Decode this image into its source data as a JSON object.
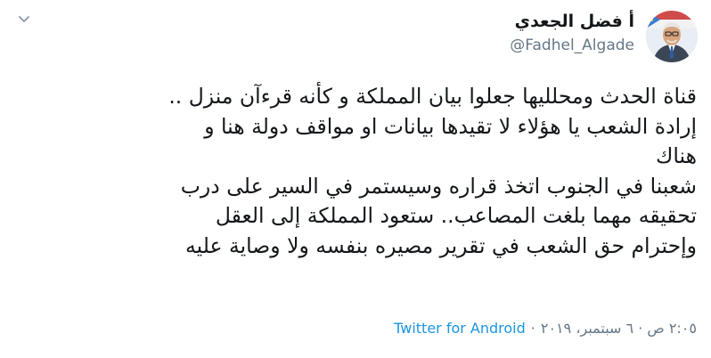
{
  "tweet": {
    "author": {
      "display_name": "أ فضل الجعدي",
      "handle": "@Fadhel_Algade"
    },
    "text": "قناة الحدث ومحلليها جعلوا بيان المملكة و كأنه قرءآن منزل ..\nإرادة الشعب يا هؤلاء لا تقيدها بيانات او مواقف دولة هنا و\nهناك\nشعبنا في الجنوب اتخذ قراره وسيستمر في السير على درب\nتحقيقه مهما بلغت المصاعب.. ستعود المملكة إلى العقل\nوإحترام حق الشعب في تقرير مصيره بنفسه ولا وصاية عليه",
    "timestamp": "٢:٠٥ ص · ٦ سبتمبر، ٢٠١٩",
    "separator": "·",
    "source": "Twitter for Android"
  },
  "colors": {
    "text": "#14171a",
    "secondary": "#657786",
    "link": "#1b95e0",
    "background": "#ffffff"
  },
  "icons": {
    "menu": "chevron-down-icon",
    "avatar": "profile-photo"
  }
}
